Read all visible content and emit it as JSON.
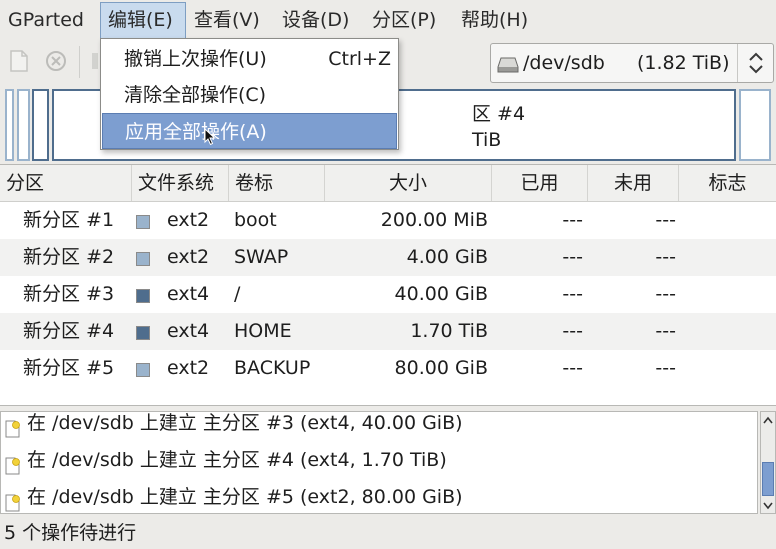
{
  "menubar": {
    "items": [
      {
        "label": "GParted"
      },
      {
        "label": "编辑(E)"
      },
      {
        "label": "查看(V)"
      },
      {
        "label": "设备(D)"
      },
      {
        "label": "分区(P)"
      },
      {
        "label": "帮助(H)"
      }
    ],
    "open_menu": "编辑(E)"
  },
  "edit_menu": {
    "items": [
      {
        "label": "撤销上次操作(U)",
        "accel": "Ctrl+Z",
        "state": "normal"
      },
      {
        "label": "清除全部操作(C)",
        "accel": "",
        "state": "normal"
      },
      {
        "label": "应用全部操作(A)",
        "accel": "",
        "state": "hovered"
      }
    ]
  },
  "toolbar": {
    "icons": [
      "new-icon",
      "delete-icon",
      "partially-hidden-icon"
    ]
  },
  "device": {
    "name": "/dev/sdb",
    "size": "(1.82 TiB)",
    "icon": "drive-icon"
  },
  "disk_map": {
    "label_line1": "区 #4",
    "label_line2": "TiB"
  },
  "table": {
    "headers": [
      "分区",
      "文件系统",
      "卷标",
      "大小",
      "已用",
      "未用",
      "标志"
    ],
    "rows": [
      {
        "partition": "新分区 #1",
        "fs": "ext2",
        "fs_color": "#9ab3cc",
        "label": "boot",
        "size": "200.00 MiB",
        "used": "---",
        "unused": "---",
        "flags": ""
      },
      {
        "partition": "新分区 #2",
        "fs": "ext2",
        "fs_color": "#9ab3cc",
        "label": "SWAP",
        "size": "4.00 GiB",
        "used": "---",
        "unused": "---",
        "flags": ""
      },
      {
        "partition": "新分区 #3",
        "fs": "ext4",
        "fs_color": "#4f6d8d",
        "label": "/",
        "size": "40.00 GiB",
        "used": "---",
        "unused": "---",
        "flags": ""
      },
      {
        "partition": "新分区 #4",
        "fs": "ext4",
        "fs_color": "#4f6d8d",
        "label": "HOME",
        "size": "1.70 TiB",
        "used": "---",
        "unused": "---",
        "flags": ""
      },
      {
        "partition": "新分区 #5",
        "fs": "ext2",
        "fs_color": "#9ab3cc",
        "label": "BACKUP",
        "size": "80.00 GiB",
        "used": "---",
        "unused": "---",
        "flags": ""
      }
    ]
  },
  "operations": [
    {
      "text": "在 /dev/sdb 上建立 主分区 #3 (ext4, 40.00 GiB)"
    },
    {
      "text": "在 /dev/sdb 上建立 主分区 #4 (ext4, 1.70 TiB)"
    },
    {
      "text": "在 /dev/sdb 上建立 主分区 #5 (ext2, 80.00 GiB)"
    }
  ],
  "status": {
    "text": "5 个操作待进行"
  }
}
